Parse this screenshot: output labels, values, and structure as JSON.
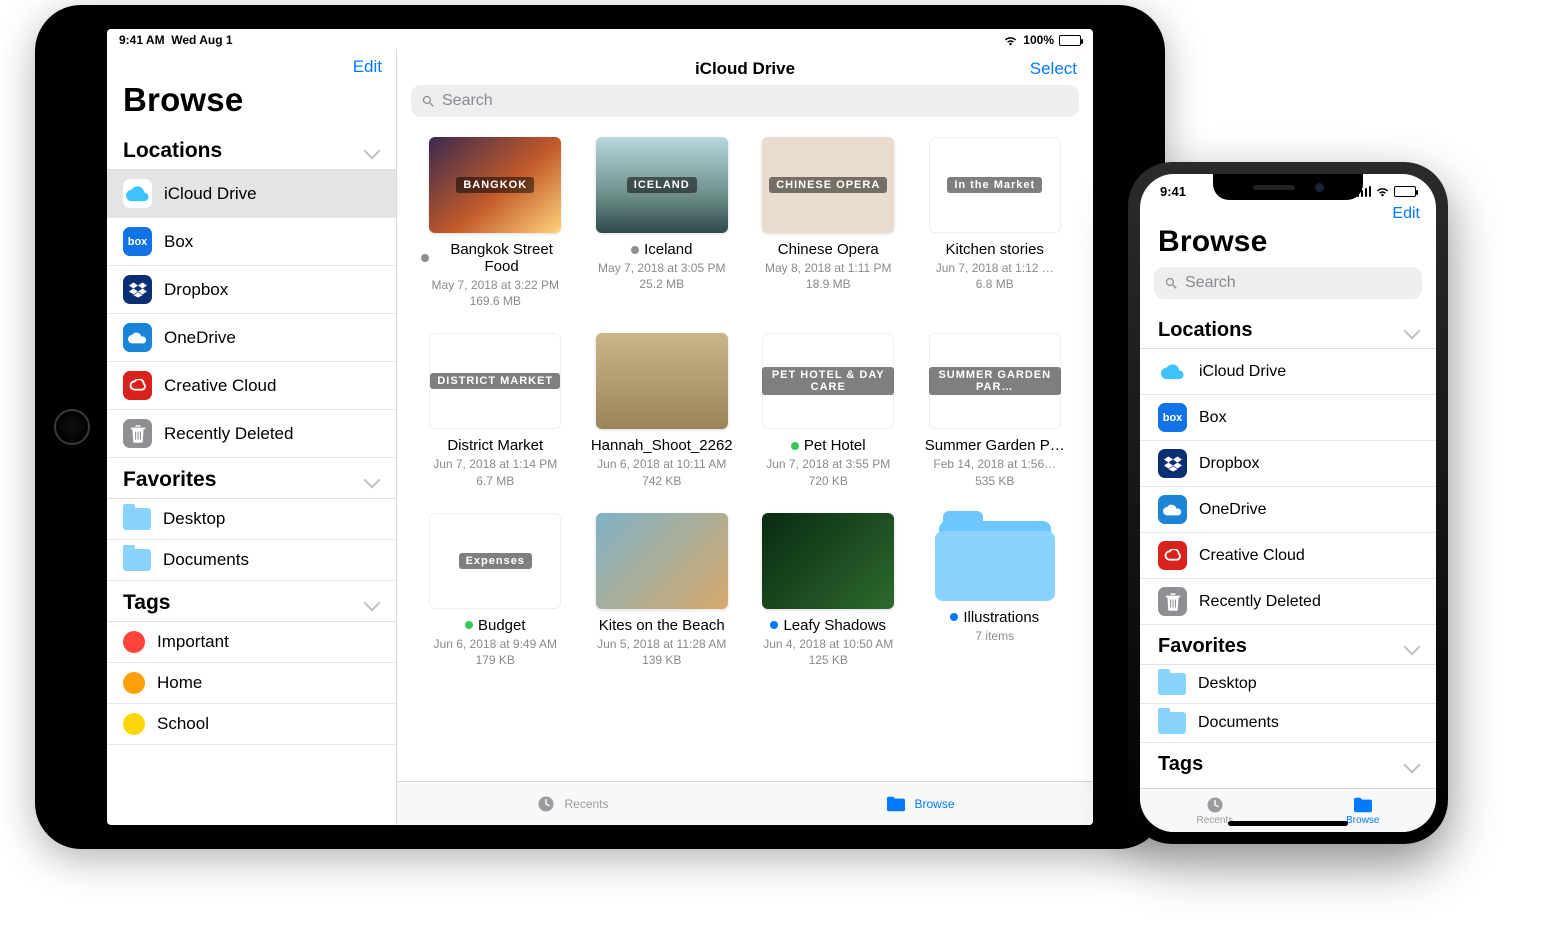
{
  "ipad": {
    "status": {
      "time": "9:41 AM",
      "date": "Wed Aug 1",
      "battery_pct": "100%"
    },
    "sidebar": {
      "edit": "Edit",
      "title": "Browse",
      "sections": {
        "locations": {
          "header": "Locations",
          "items": [
            {
              "label": "iCloud Drive",
              "icon": "icloud",
              "selected": true
            },
            {
              "label": "Box",
              "icon": "box"
            },
            {
              "label": "Dropbox",
              "icon": "dropbox"
            },
            {
              "label": "OneDrive",
              "icon": "onedrive"
            },
            {
              "label": "Creative Cloud",
              "icon": "creative-cloud"
            },
            {
              "label": "Recently Deleted",
              "icon": "trash"
            }
          ]
        },
        "favorites": {
          "header": "Favorites",
          "items": [
            {
              "label": "Desktop",
              "icon": "folder"
            },
            {
              "label": "Documents",
              "icon": "folder"
            }
          ]
        },
        "tags": {
          "header": "Tags",
          "items": [
            {
              "label": "Important",
              "color": "#ff453a"
            },
            {
              "label": "Home",
              "color": "#ff9f0a"
            },
            {
              "label": "School",
              "color": "#ffd60a"
            }
          ]
        }
      }
    },
    "main": {
      "title": "iCloud Drive",
      "select": "Select",
      "search_placeholder": "Search",
      "files": [
        {
          "name": "Bangkok Street Food",
          "date": "May 7, 2018 at 3:22 PM",
          "size": "169.6 MB",
          "status": "gray",
          "thumb": "th-bangkok",
          "thumb_label": "BANGKOK"
        },
        {
          "name": "Iceland",
          "date": "May 7, 2018 at 3:05 PM",
          "size": "25.2 MB",
          "status": "gray",
          "thumb": "th-iceland",
          "thumb_label": "ICELAND"
        },
        {
          "name": "Chinese Opera",
          "date": "May 8, 2018 at 1:11 PM",
          "size": "18.9 MB",
          "thumb": "th-opera",
          "thumb_label": "CHINESE OPERA"
        },
        {
          "name": "Kitchen stories",
          "date": "Jun 7, 2018 at 1:12 …",
          "size": "6.8 MB",
          "thumb": "th-kitchen",
          "thumb_label": "In the Market"
        },
        {
          "name": "District Market",
          "date": "Jun 7, 2018 at 1:14 PM",
          "size": "6.7 MB",
          "thumb": "th-district",
          "thumb_label": "DISTRICT MARKET"
        },
        {
          "name": "Hannah_Shoot_2262",
          "date": "Jun 6, 2018 at 10:11 AM",
          "size": "742 KB",
          "thumb": "th-hannah"
        },
        {
          "name": "Pet Hotel",
          "date": "Jun 7, 2018 at 3:55 PM",
          "size": "720 KB",
          "status": "green",
          "thumb": "th-pet",
          "thumb_label": "PET HOTEL & DAY CARE"
        },
        {
          "name": "Summer Garden P…",
          "date": "Feb 14, 2018 at 1:56…",
          "size": "535 KB",
          "thumb": "th-summer",
          "thumb_label": "SUMMER GARDEN PAR…"
        },
        {
          "name": "Budget",
          "date": "Jun 6, 2018 at 9:49 AM",
          "size": "179 KB",
          "status": "green",
          "thumb": "th-budget",
          "thumb_label": "Expenses"
        },
        {
          "name": "Kites on the Beach",
          "date": "Jun 5, 2018 at 11:28 AM",
          "size": "139 KB",
          "thumb": "th-kites"
        },
        {
          "name": "Leafy Shadows",
          "date": "Jun 4, 2018 at 10:50 AM",
          "size": "125 KB",
          "status": "blue",
          "thumb": "th-leafy"
        },
        {
          "name": "Illustrations",
          "date": "7 items",
          "size": "",
          "status": "blue",
          "is_folder": true
        }
      ]
    },
    "tabs": {
      "recents": "Recents",
      "browse": "Browse"
    }
  },
  "iphone": {
    "status": {
      "time": "9:41"
    },
    "edit": "Edit",
    "title": "Browse",
    "search_placeholder": "Search",
    "sections": {
      "locations": {
        "header": "Locations",
        "items": [
          {
            "label": "iCloud Drive",
            "icon": "icloud"
          },
          {
            "label": "Box",
            "icon": "box"
          },
          {
            "label": "Dropbox",
            "icon": "dropbox"
          },
          {
            "label": "OneDrive",
            "icon": "onedrive"
          },
          {
            "label": "Creative Cloud",
            "icon": "creative-cloud"
          },
          {
            "label": "Recently Deleted",
            "icon": "trash"
          }
        ]
      },
      "favorites": {
        "header": "Favorites",
        "items": [
          {
            "label": "Desktop",
            "icon": "folder"
          },
          {
            "label": "Documents",
            "icon": "folder"
          }
        ]
      },
      "tags": {
        "header": "Tags"
      }
    },
    "tabs": {
      "recents": "Recents",
      "browse": "Browse"
    }
  },
  "status_colors": {
    "gray": "#8e8e93",
    "green": "#34c759",
    "blue": "#007aff"
  }
}
